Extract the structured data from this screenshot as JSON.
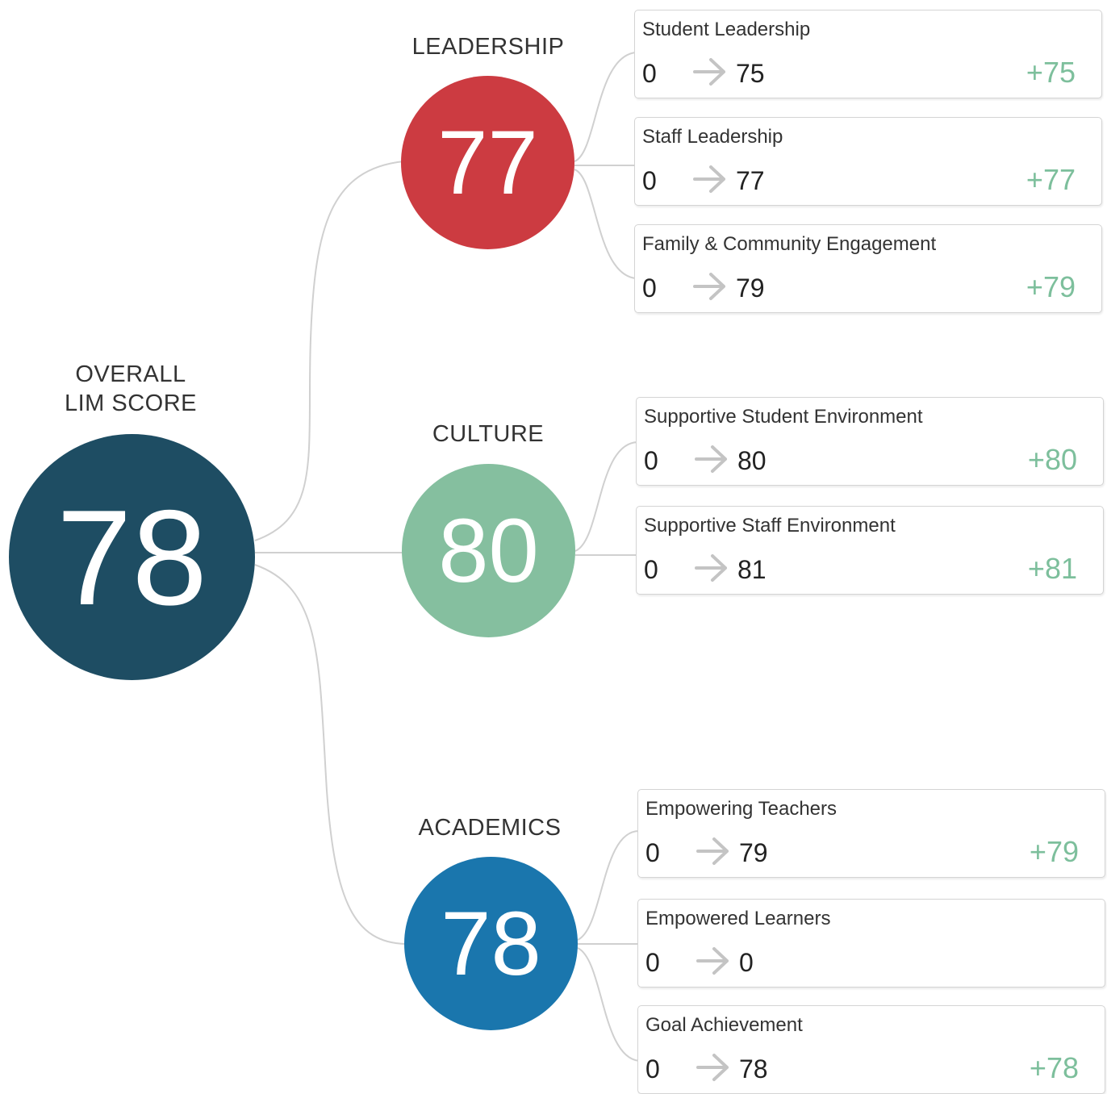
{
  "overall": {
    "label_line1": "OVERALL",
    "label_line2": "LIM SCORE",
    "score": "78",
    "color": "#1e4d63"
  },
  "categories": [
    {
      "label": "LEADERSHIP",
      "score": "77",
      "color": "#cc3b41",
      "items": [
        {
          "title": "Student Leadership",
          "from": "0",
          "to": "75",
          "delta": "+75"
        },
        {
          "title": "Staff Leadership",
          "from": "0",
          "to": "77",
          "delta": "+77"
        },
        {
          "title": "Family & Community Engagement",
          "from": "0",
          "to": "79",
          "delta": "+79"
        }
      ]
    },
    {
      "label": "CULTURE",
      "score": "80",
      "color": "#85bf9f",
      "items": [
        {
          "title": "Supportive Student Environment",
          "from": "0",
          "to": "80",
          "delta": "+80"
        },
        {
          "title": "Supportive Staff Environment",
          "from": "0",
          "to": "81",
          "delta": "+81"
        }
      ]
    },
    {
      "label": "ACADEMICS",
      "score": "78",
      "color": "#1a76ad",
      "items": [
        {
          "title": "Empowering Teachers",
          "from": "0",
          "to": "79",
          "delta": "+79"
        },
        {
          "title": "Empowered Learners",
          "from": "0",
          "to": "0",
          "delta": ""
        },
        {
          "title": "Goal Achievement",
          "from": "0",
          "to": "78",
          "delta": "+78"
        }
      ]
    }
  ],
  "colors": {
    "connector": "#d0d0d0",
    "delta": "#7dbf9c",
    "arrow": "#c4c4c4"
  },
  "icons": {
    "transition": "right-arrow-icon"
  }
}
